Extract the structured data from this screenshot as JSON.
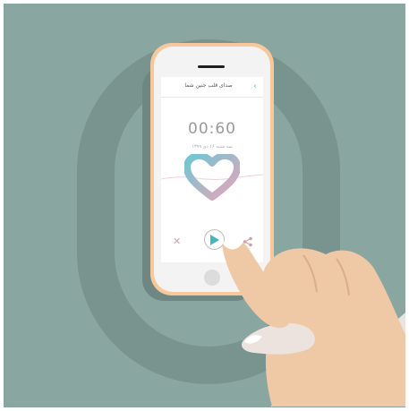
{
  "colors": {
    "background": "#8aa6a1",
    "ring": "#79938f",
    "phone_frame": "#f7c99a",
    "accent": "#44b5c3",
    "heart_gradient_start": "#6ec7d4",
    "heart_gradient_end": "#e8a4b8"
  },
  "app": {
    "title": "صدای قلب جنین شما",
    "back_icon": "chevron-right-icon",
    "timer": "00:60",
    "date": "سه شنبه ۱۶ دی ۱۳۹۹"
  },
  "controls": {
    "play_icon": "play-icon",
    "close_icon": "close-icon",
    "share_icon": "share-icon",
    "close_glyph": "✕",
    "back_glyph": "‹"
  }
}
